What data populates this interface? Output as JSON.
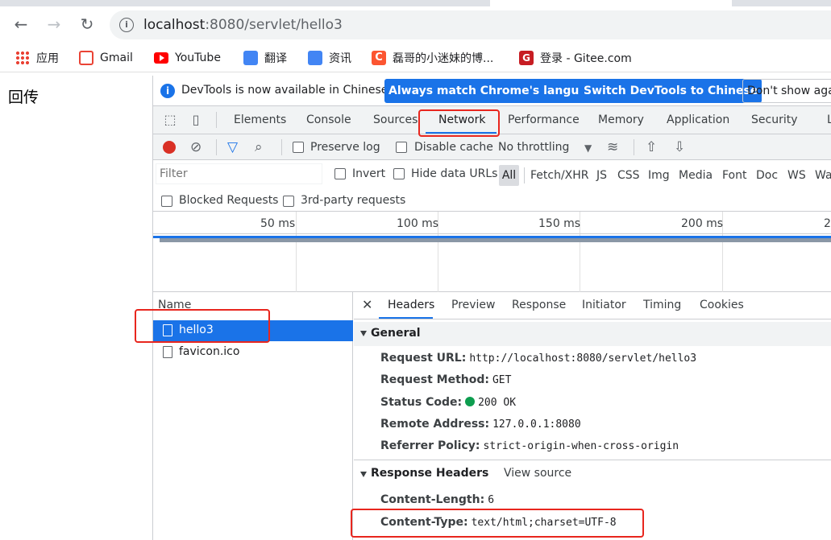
{
  "browser": {
    "url_host": "localhost",
    "url_rest": ":8080/servlet/hello3",
    "bookmarks": [
      "应用",
      "Gmail",
      "YouTube",
      "翻译",
      "资讯",
      "磊哥的小迷妹的博...",
      "登录 - Gitee.com"
    ]
  },
  "page": {
    "text": "回传"
  },
  "devtools": {
    "infobar": {
      "message": "DevTools is now available in Chinese!",
      "btn_match": "Always match Chrome's language",
      "btn_switch": "Switch DevTools to Chinese",
      "btn_dismiss": "Don't show again"
    },
    "tabs": [
      "Elements",
      "Console",
      "Sources",
      "Network",
      "Performance",
      "Memory",
      "Application",
      "Security",
      "L"
    ],
    "active_tab": "Network",
    "network_toolbar": {
      "preserve_log": "Preserve log",
      "disable_cache": "Disable cache",
      "throttling": "No throttling"
    },
    "filter": {
      "placeholder": "Filter",
      "invert": "Invert",
      "hide_data_urls": "Hide data URLs",
      "types": [
        "All",
        "Fetch/XHR",
        "JS",
        "CSS",
        "Img",
        "Media",
        "Font",
        "Doc",
        "WS",
        "Wa"
      ],
      "blocked_requests": "Blocked Requests",
      "third_party": "3rd-party requests"
    },
    "timeline_ticks": [
      "50 ms",
      "100 ms",
      "150 ms",
      "200 ms",
      "2"
    ],
    "requests": {
      "header": "Name",
      "items": [
        "hello3",
        "favicon.ico"
      ]
    },
    "detail_tabs": [
      "Headers",
      "Preview",
      "Response",
      "Initiator",
      "Timing",
      "Cookies"
    ],
    "general": {
      "title": "General",
      "request_url_k": "Request URL:",
      "request_url_v": "http://localhost:8080/servlet/hello3",
      "method_k": "Request Method:",
      "method_v": "GET",
      "status_k": "Status Code:",
      "status_v": "200 OK",
      "remote_k": "Remote Address:",
      "remote_v": "127.0.0.1:8080",
      "referrer_k": "Referrer Policy:",
      "referrer_v": "strict-origin-when-cross-origin"
    },
    "response_headers": {
      "title": "Response Headers",
      "view_source": "View source",
      "content_length_k": "Content-Length:",
      "content_length_v": "6",
      "content_type_k": "Content-Type:",
      "content_type_v": "text/html;charset=UTF-8"
    }
  },
  "colors": {
    "accent": "#1a73e8",
    "annotation_red": "#e8261e",
    "status_ok": "#0d9d4f"
  }
}
